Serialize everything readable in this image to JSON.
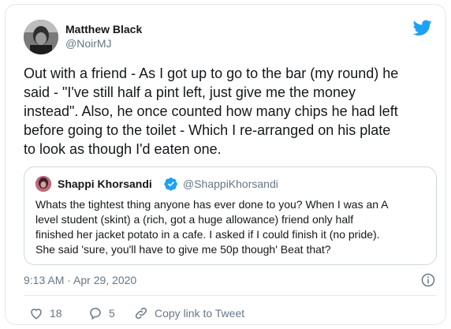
{
  "tweet": {
    "author_name": "Matthew Black",
    "author_handle": "@NoirMJ",
    "text": "Out with a friend - As I got up to go to the bar (my round)  he\nsaid - \"I've still half a pint left, just give me the money\ninstead\". Also, he once counted how many chips he had left\nbefore going to the toilet - Which I re-arranged on his plate\nto look as though I'd eaten one.",
    "timestamp": "9:13 AM · Apr 29, 2020",
    "like_count": "18",
    "reply_count": "5",
    "copy_link_label": "Copy link to Tweet"
  },
  "quoted_tweet": {
    "author_name": "Shappi Khorsandi",
    "author_handle": "@ShappiKhorsandi",
    "text": "Whats the tightest thing anyone has ever done to you? When I was an A\nlevel student (skint) a (rich, got a huge allowance) friend only half\nfinished her jacket potato in a cafe. I asked if I could finish it (no pride).\nShe said 'sure, you'll have to give me 50p though' Beat that?"
  },
  "colors": {
    "twitter_blue": "#1da1f2",
    "text_secondary": "#657786",
    "border": "#e1e8ed"
  },
  "icons": [
    "twitter-logo-icon",
    "verified-badge-icon",
    "info-icon",
    "heart-icon",
    "reply-icon",
    "link-icon"
  ]
}
